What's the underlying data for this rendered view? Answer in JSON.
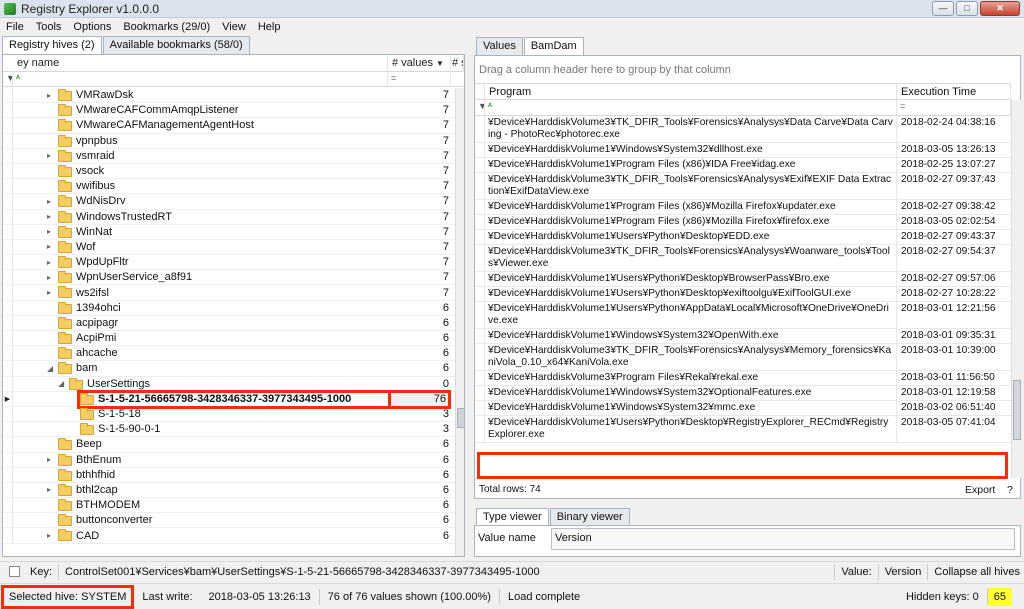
{
  "window": {
    "title": "Registry Explorer v1.0.0.0"
  },
  "menu": [
    "File",
    "Tools",
    "Options",
    "Bookmarks (29/0)",
    "View",
    "Help"
  ],
  "left": {
    "tabs": [
      "Registry hives (2)",
      "Available bookmarks (58/0)"
    ],
    "col_key_name": "ey name",
    "col_values": "# values",
    "col_extra": "# s",
    "filter_glyph": "ᴬ",
    "filter_eq": "=",
    "rows": [
      {
        "name": "VMRawDsk",
        "values": "7",
        "expand": "▸",
        "level": 0
      },
      {
        "name": "VMwareCAFCommAmqpListener",
        "values": "7",
        "expand": "",
        "level": 0
      },
      {
        "name": "VMwareCAFManagementAgentHost",
        "values": "7",
        "expand": "",
        "level": 0
      },
      {
        "name": "vpnpbus",
        "values": "7",
        "expand": "",
        "level": 0
      },
      {
        "name": "vsmraid",
        "values": "7",
        "expand": "▸",
        "level": 0
      },
      {
        "name": "vsock",
        "values": "7",
        "expand": "",
        "level": 0
      },
      {
        "name": "vwifibus",
        "values": "7",
        "expand": "",
        "level": 0
      },
      {
        "name": "WdNisDrv",
        "values": "7",
        "expand": "▸",
        "level": 0
      },
      {
        "name": "WindowsTrustedRT",
        "values": "7",
        "expand": "▸",
        "level": 0
      },
      {
        "name": "WinNat",
        "values": "7",
        "expand": "▸",
        "level": 0
      },
      {
        "name": "Wof",
        "values": "7",
        "expand": "▸",
        "level": 0
      },
      {
        "name": "WpdUpFltr",
        "values": "7",
        "expand": "▸",
        "level": 0
      },
      {
        "name": "WpnUserService_a8f91",
        "values": "7",
        "expand": "▸",
        "level": 0
      },
      {
        "name": "ws2ifsl",
        "values": "7",
        "expand": "▸",
        "level": 0
      },
      {
        "name": "1394ohci",
        "values": "6",
        "expand": "",
        "level": 0
      },
      {
        "name": "acpipagr",
        "values": "6",
        "expand": "",
        "level": 0
      },
      {
        "name": "AcpiPmi",
        "values": "6",
        "expand": "",
        "level": 0
      },
      {
        "name": "ahcache",
        "values": "6",
        "expand": "",
        "level": 0
      },
      {
        "name": "bam",
        "values": "6",
        "expand": "◢",
        "level": 0
      },
      {
        "name": "UserSettings",
        "values": "0",
        "expand": "◢",
        "level": 1
      },
      {
        "name": "S-1-5-21-56665798-3428346337-3977343495-1000",
        "values": "76",
        "expand": "",
        "level": 2,
        "selected": true
      },
      {
        "name": "S-1-5-18",
        "values": "3",
        "expand": "",
        "level": 2
      },
      {
        "name": "S-1-5-90-0-1",
        "values": "3",
        "expand": "",
        "level": 2
      },
      {
        "name": "Beep",
        "values": "6",
        "expand": "",
        "level": 0
      },
      {
        "name": "BthEnum",
        "values": "6",
        "expand": "▸",
        "level": 0
      },
      {
        "name": "bthhfhid",
        "values": "6",
        "expand": "",
        "level": 0
      },
      {
        "name": "bthl2cap",
        "values": "6",
        "expand": "▸",
        "level": 0
      },
      {
        "name": "BTHMODEM",
        "values": "6",
        "expand": "",
        "level": 0
      },
      {
        "name": "buttonconverter",
        "values": "6",
        "expand": "",
        "level": 0
      },
      {
        "name": "CAD",
        "values": "6",
        "expand": "▸",
        "level": 0
      }
    ]
  },
  "right": {
    "tabs": [
      "Values",
      "BamDam"
    ],
    "group_hint": "Drag a column header here to group by that column",
    "col_program": "Program",
    "col_exec_time": "Execution Time",
    "filter_glyph": "ᴬ",
    "filter_eq": "=",
    "rows": [
      {
        "program": "¥Device¥HarddiskVolume3¥TK_DFIR_Tools¥Forensics¥Analysys¥Data Carve¥Data Carving - PhotoRec¥photorec.exe",
        "time": "2018-02-24 04:38:16"
      },
      {
        "program": "¥Device¥HarddiskVolume1¥Windows¥System32¥dllhost.exe",
        "time": "2018-03-05 13:26:13"
      },
      {
        "program": "¥Device¥HarddiskVolume1¥Program Files (x86)¥IDA Free¥idag.exe",
        "time": "2018-02-25 13:07:27"
      },
      {
        "program": "¥Device¥HarddiskVolume3¥TK_DFIR_Tools¥Forensics¥Analysys¥Exif¥EXIF Data Extraction¥ExifDataView.exe",
        "time": "2018-02-27 09:37:43"
      },
      {
        "program": "¥Device¥HarddiskVolume1¥Program Files (x86)¥Mozilla Firefox¥updater.exe",
        "time": "2018-02-27 09:38:42"
      },
      {
        "program": "¥Device¥HarddiskVolume1¥Program Files (x86)¥Mozilla Firefox¥firefox.exe",
        "time": "2018-03-05 02:02:54"
      },
      {
        "program": "¥Device¥HarddiskVolume1¥Users¥Python¥Desktop¥EDD.exe",
        "time": "2018-02-27 09:43:37"
      },
      {
        "program": "¥Device¥HarddiskVolume3¥TK_DFIR_Tools¥Forensics¥Analysys¥Woanware_tools¥Tools¥Viewer.exe",
        "time": "2018-02-27 09:54:37"
      },
      {
        "program": "¥Device¥HarddiskVolume1¥Users¥Python¥Desktop¥BrowserPass¥Bro.exe",
        "time": "2018-02-27 09:57:06"
      },
      {
        "program": "¥Device¥HarddiskVolume1¥Users¥Python¥Desktop¥exiftoolgu¥ExifToolGUI.exe",
        "time": "2018-02-27 10:28:22"
      },
      {
        "program": "¥Device¥HarddiskVolume1¥Users¥Python¥AppData¥Local¥Microsoft¥OneDrive¥OneDrive.exe",
        "time": "2018-03-01 12:21:56"
      },
      {
        "program": "¥Device¥HarddiskVolume1¥Windows¥System32¥OpenWith.exe",
        "time": "2018-03-01 09:35:31"
      },
      {
        "program": "¥Device¥HarddiskVolume3¥TK_DFIR_Tools¥Forensics¥Analysys¥Memory_forensics¥KaniVola_0.10_x64¥KaniVola.exe",
        "time": "2018-03-01 10:39:00"
      },
      {
        "program": "¥Device¥HarddiskVolume3¥Program Files¥Rekal¥rekal.exe",
        "time": "2018-03-01 11:56:50"
      },
      {
        "program": "¥Device¥HarddiskVolume1¥Windows¥System32¥OptionalFeatures.exe",
        "time": "2018-03-01 12:19:58"
      },
      {
        "program": "¥Device¥HarddiskVolume1¥Windows¥System32¥mmc.exe",
        "time": "2018-03-02 06:51:40"
      },
      {
        "program": "¥Device¥HarddiskVolume1¥Users¥Python¥Desktop¥RegistryExplorer_RECmd¥RegistryExplorer.exe",
        "time": "2018-03-05 07:41:04"
      }
    ],
    "total_rows": "Total rows: 74",
    "export": "Export",
    "help": "?"
  },
  "type_viewer": {
    "tabs": [
      "Type viewer",
      "Binary viewer"
    ],
    "value_name_label": "Value name",
    "value_name": "Version"
  },
  "keybar": {
    "key_label": "Key:",
    "key_path": "ControlSet001¥Services¥bam¥UserSettings¥S-1-5-21-56665798-3428346337-3977343495-1000",
    "value_label": "Value:",
    "value": "Version",
    "collapse": "Collapse all hives"
  },
  "status": {
    "selected_hive": "Selected hive: SYSTEM",
    "last_write_label": "Last write:",
    "last_write": "2018-03-05 13:26:13",
    "values_shown": "76 of 76 values shown (100.00%)",
    "load": "Load complete",
    "hidden_keys": "Hidden keys: 0",
    "count": "65"
  }
}
